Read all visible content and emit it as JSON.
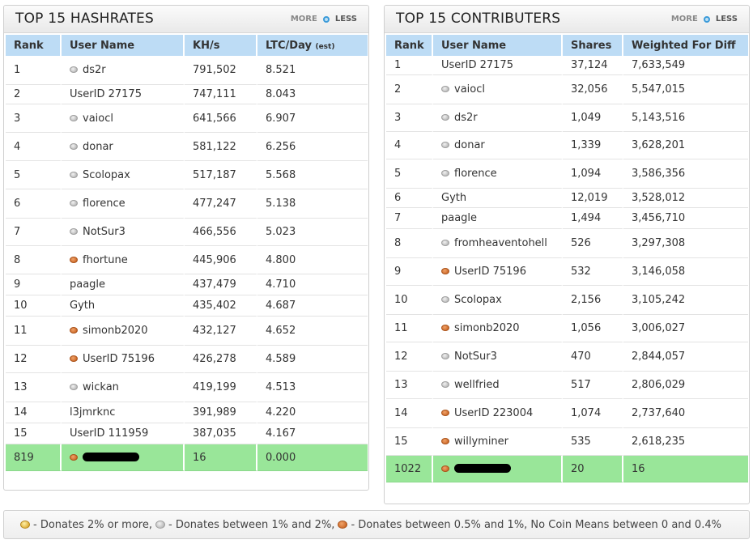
{
  "controls": {
    "more": "MORE",
    "less": "LESS"
  },
  "hashrates": {
    "title": "TOP 15 HASHRATES",
    "columns": {
      "rank": "Rank",
      "user": "User Name",
      "khs": "KH/s",
      "ltc": "LTC/Day",
      "ltc_note": "(est)"
    },
    "rows": [
      {
        "rank": "1",
        "coin": "silver",
        "user": "ds2r",
        "khs": "791,502",
        "ltc": "8.521"
      },
      {
        "rank": "2",
        "coin": "",
        "user": "UserID 27175",
        "khs": "747,111",
        "ltc": "8.043"
      },
      {
        "rank": "3",
        "coin": "silver",
        "user": "vaiocl",
        "khs": "641,566",
        "ltc": "6.907"
      },
      {
        "rank": "4",
        "coin": "silver",
        "user": "donar",
        "khs": "581,122",
        "ltc": "6.256"
      },
      {
        "rank": "5",
        "coin": "silver",
        "user": "Scolopax",
        "khs": "517,187",
        "ltc": "5.568"
      },
      {
        "rank": "6",
        "coin": "silver",
        "user": "florence",
        "khs": "477,247",
        "ltc": "5.138"
      },
      {
        "rank": "7",
        "coin": "silver",
        "user": "NotSur3",
        "khs": "466,556",
        "ltc": "5.023"
      },
      {
        "rank": "8",
        "coin": "bronze",
        "user": "fhortune",
        "khs": "445,906",
        "ltc": "4.800"
      },
      {
        "rank": "9",
        "coin": "",
        "user": "paagle",
        "khs": "437,479",
        "ltc": "4.710"
      },
      {
        "rank": "10",
        "coin": "",
        "user": "Gyth",
        "khs": "435,402",
        "ltc": "4.687"
      },
      {
        "rank": "11",
        "coin": "bronze",
        "user": "simonb2020",
        "khs": "432,127",
        "ltc": "4.652"
      },
      {
        "rank": "12",
        "coin": "bronze",
        "user": "UserID 75196",
        "khs": "426,278",
        "ltc": "4.589"
      },
      {
        "rank": "13",
        "coin": "silver",
        "user": "wickan",
        "khs": "419,199",
        "ltc": "4.513"
      },
      {
        "rank": "14",
        "coin": "",
        "user": "l3jmrknc",
        "khs": "391,989",
        "ltc": "4.220"
      },
      {
        "rank": "15",
        "coin": "",
        "user": "UserID 111959",
        "khs": "387,035",
        "ltc": "4.167"
      }
    ],
    "me": {
      "rank": "819",
      "coin": "bronze",
      "khs": "16",
      "ltc": "0.000"
    }
  },
  "contributers": {
    "title": "TOP 15 CONTRIBUTERS",
    "columns": {
      "rank": "Rank",
      "user": "User Name",
      "shares": "Shares",
      "weighted": "Weighted For Diff"
    },
    "rows": [
      {
        "rank": "1",
        "coin": "",
        "user": "UserID 27175",
        "shares": "37,124",
        "weighted": "7,633,549"
      },
      {
        "rank": "2",
        "coin": "silver",
        "user": "vaiocl",
        "shares": "32,056",
        "weighted": "5,547,015"
      },
      {
        "rank": "3",
        "coin": "silver",
        "user": "ds2r",
        "shares": "1,049",
        "weighted": "5,143,516"
      },
      {
        "rank": "4",
        "coin": "silver",
        "user": "donar",
        "shares": "1,339",
        "weighted": "3,628,201"
      },
      {
        "rank": "5",
        "coin": "silver",
        "user": "florence",
        "shares": "1,094",
        "weighted": "3,586,356"
      },
      {
        "rank": "6",
        "coin": "",
        "user": "Gyth",
        "shares": "12,019",
        "weighted": "3,528,012"
      },
      {
        "rank": "7",
        "coin": "",
        "user": "paagle",
        "shares": "1,494",
        "weighted": "3,456,710"
      },
      {
        "rank": "8",
        "coin": "silver",
        "user": "fromheaventohell",
        "shares": "526",
        "weighted": "3,297,308"
      },
      {
        "rank": "9",
        "coin": "bronze",
        "user": "UserID 75196",
        "shares": "532",
        "weighted": "3,146,058"
      },
      {
        "rank": "10",
        "coin": "silver",
        "user": "Scolopax",
        "shares": "2,156",
        "weighted": "3,105,242"
      },
      {
        "rank": "11",
        "coin": "bronze",
        "user": "simonb2020",
        "shares": "1,056",
        "weighted": "3,006,027"
      },
      {
        "rank": "12",
        "coin": "silver",
        "user": "NotSur3",
        "shares": "470",
        "weighted": "2,844,057"
      },
      {
        "rank": "13",
        "coin": "silver",
        "user": "wellfried",
        "shares": "517",
        "weighted": "2,806,029"
      },
      {
        "rank": "14",
        "coin": "bronze",
        "user": "UserID 223004",
        "shares": "1,074",
        "weighted": "2,737,640"
      },
      {
        "rank": "15",
        "coin": "bronze",
        "user": "willyminer",
        "shares": "535",
        "weighted": "2,618,235"
      }
    ],
    "me": {
      "rank": "1022",
      "coin": "bronze",
      "shares": "20",
      "weighted": "16"
    }
  },
  "legend": {
    "gold": " - Donates 2% or more, ",
    "silver": " - Donates between 1% and 2%, ",
    "bronze": " - Donates between 0.5% and 1%, No Coin Means between 0 and 0.4%"
  },
  "colors": {
    "header_blue": "#bddcf5",
    "highlight_green": "#99e699",
    "accent_blue": "#3a9ad9"
  }
}
